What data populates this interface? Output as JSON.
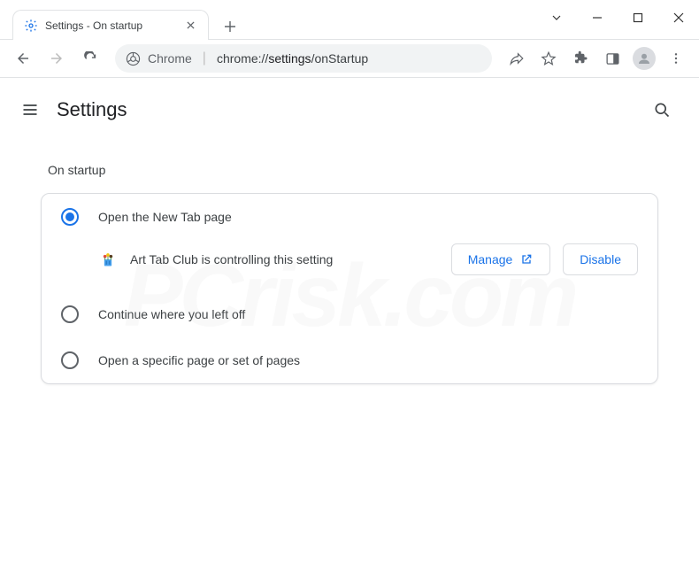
{
  "tab": {
    "title": "Settings - On startup"
  },
  "omnibox": {
    "prefix": "Chrome",
    "url_plain1": "chrome://",
    "url_bold": "settings",
    "url_plain2": "/onStartup"
  },
  "page": {
    "title": "Settings"
  },
  "section": {
    "title": "On startup"
  },
  "options": {
    "new_tab": "Open the New Tab page",
    "continue": "Continue where you left off",
    "specific": "Open a specific page or set of pages"
  },
  "control": {
    "text": "Art Tab Club is controlling this setting",
    "manage": "Manage",
    "disable": "Disable"
  },
  "watermark": "PCrisk.com"
}
